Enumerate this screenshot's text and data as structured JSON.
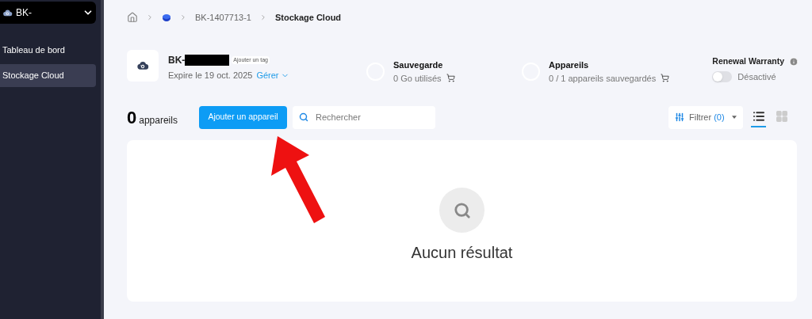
{
  "sidebar": {
    "account": "BK-",
    "items": [
      {
        "label": "Tableau de bord",
        "selected": false
      },
      {
        "label": "Stockage Cloud",
        "selected": true
      }
    ]
  },
  "breadcrumb": {
    "items": [
      "BK-1407713-1",
      "Stockage Cloud"
    ]
  },
  "subscription": {
    "name": "BK-",
    "tag_button": "Ajouter un tag",
    "expiry": "Expire le 19 oct. 2025",
    "manage": "Gérer"
  },
  "stats": [
    {
      "title": "Sauvegarde",
      "value": "0 Go utilisés"
    },
    {
      "title": "Appareils",
      "value": "0 / 1 appareils sauvegardés"
    }
  ],
  "warranty": {
    "title": "Renewal Warranty",
    "on": false,
    "state": "Désactivé"
  },
  "toolbar": {
    "count": "0",
    "count_label": "appareils",
    "add_button": "Ajouter un appareil",
    "search_placeholder": "Rechercher",
    "filter_label": "Filtrer",
    "filter_count": "(0)",
    "views": [
      {
        "kind": "list",
        "selected": true
      },
      {
        "kind": "grid",
        "selected": false
      }
    ]
  },
  "empty": {
    "message": "Aucun résultat"
  }
}
